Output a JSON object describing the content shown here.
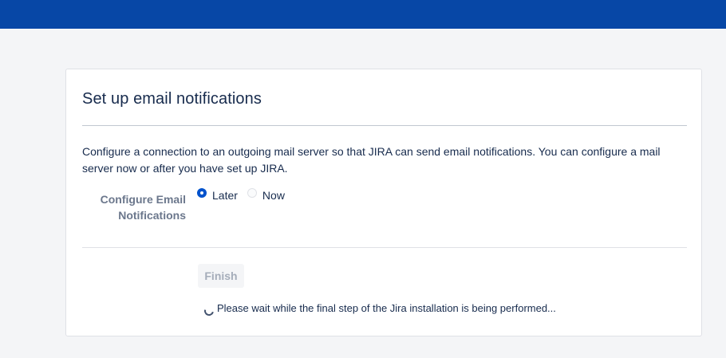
{
  "header": {
    "brand_color": "#0747a6"
  },
  "card": {
    "title": "Set up email notifications",
    "description": "Configure a connection to an outgoing mail server so that JIRA can send email notifications. You can configure a mail server now or after you have set up JIRA.",
    "field": {
      "label_line1": "Configure Email",
      "label_line2": "Notifications",
      "options": [
        {
          "label": "Later",
          "selected": true
        },
        {
          "label": "Now",
          "selected": false
        }
      ]
    },
    "finish_label": "Finish",
    "finish_disabled": true,
    "wait_message": "Please wait while the final step of the Jira installation is being performed..."
  }
}
